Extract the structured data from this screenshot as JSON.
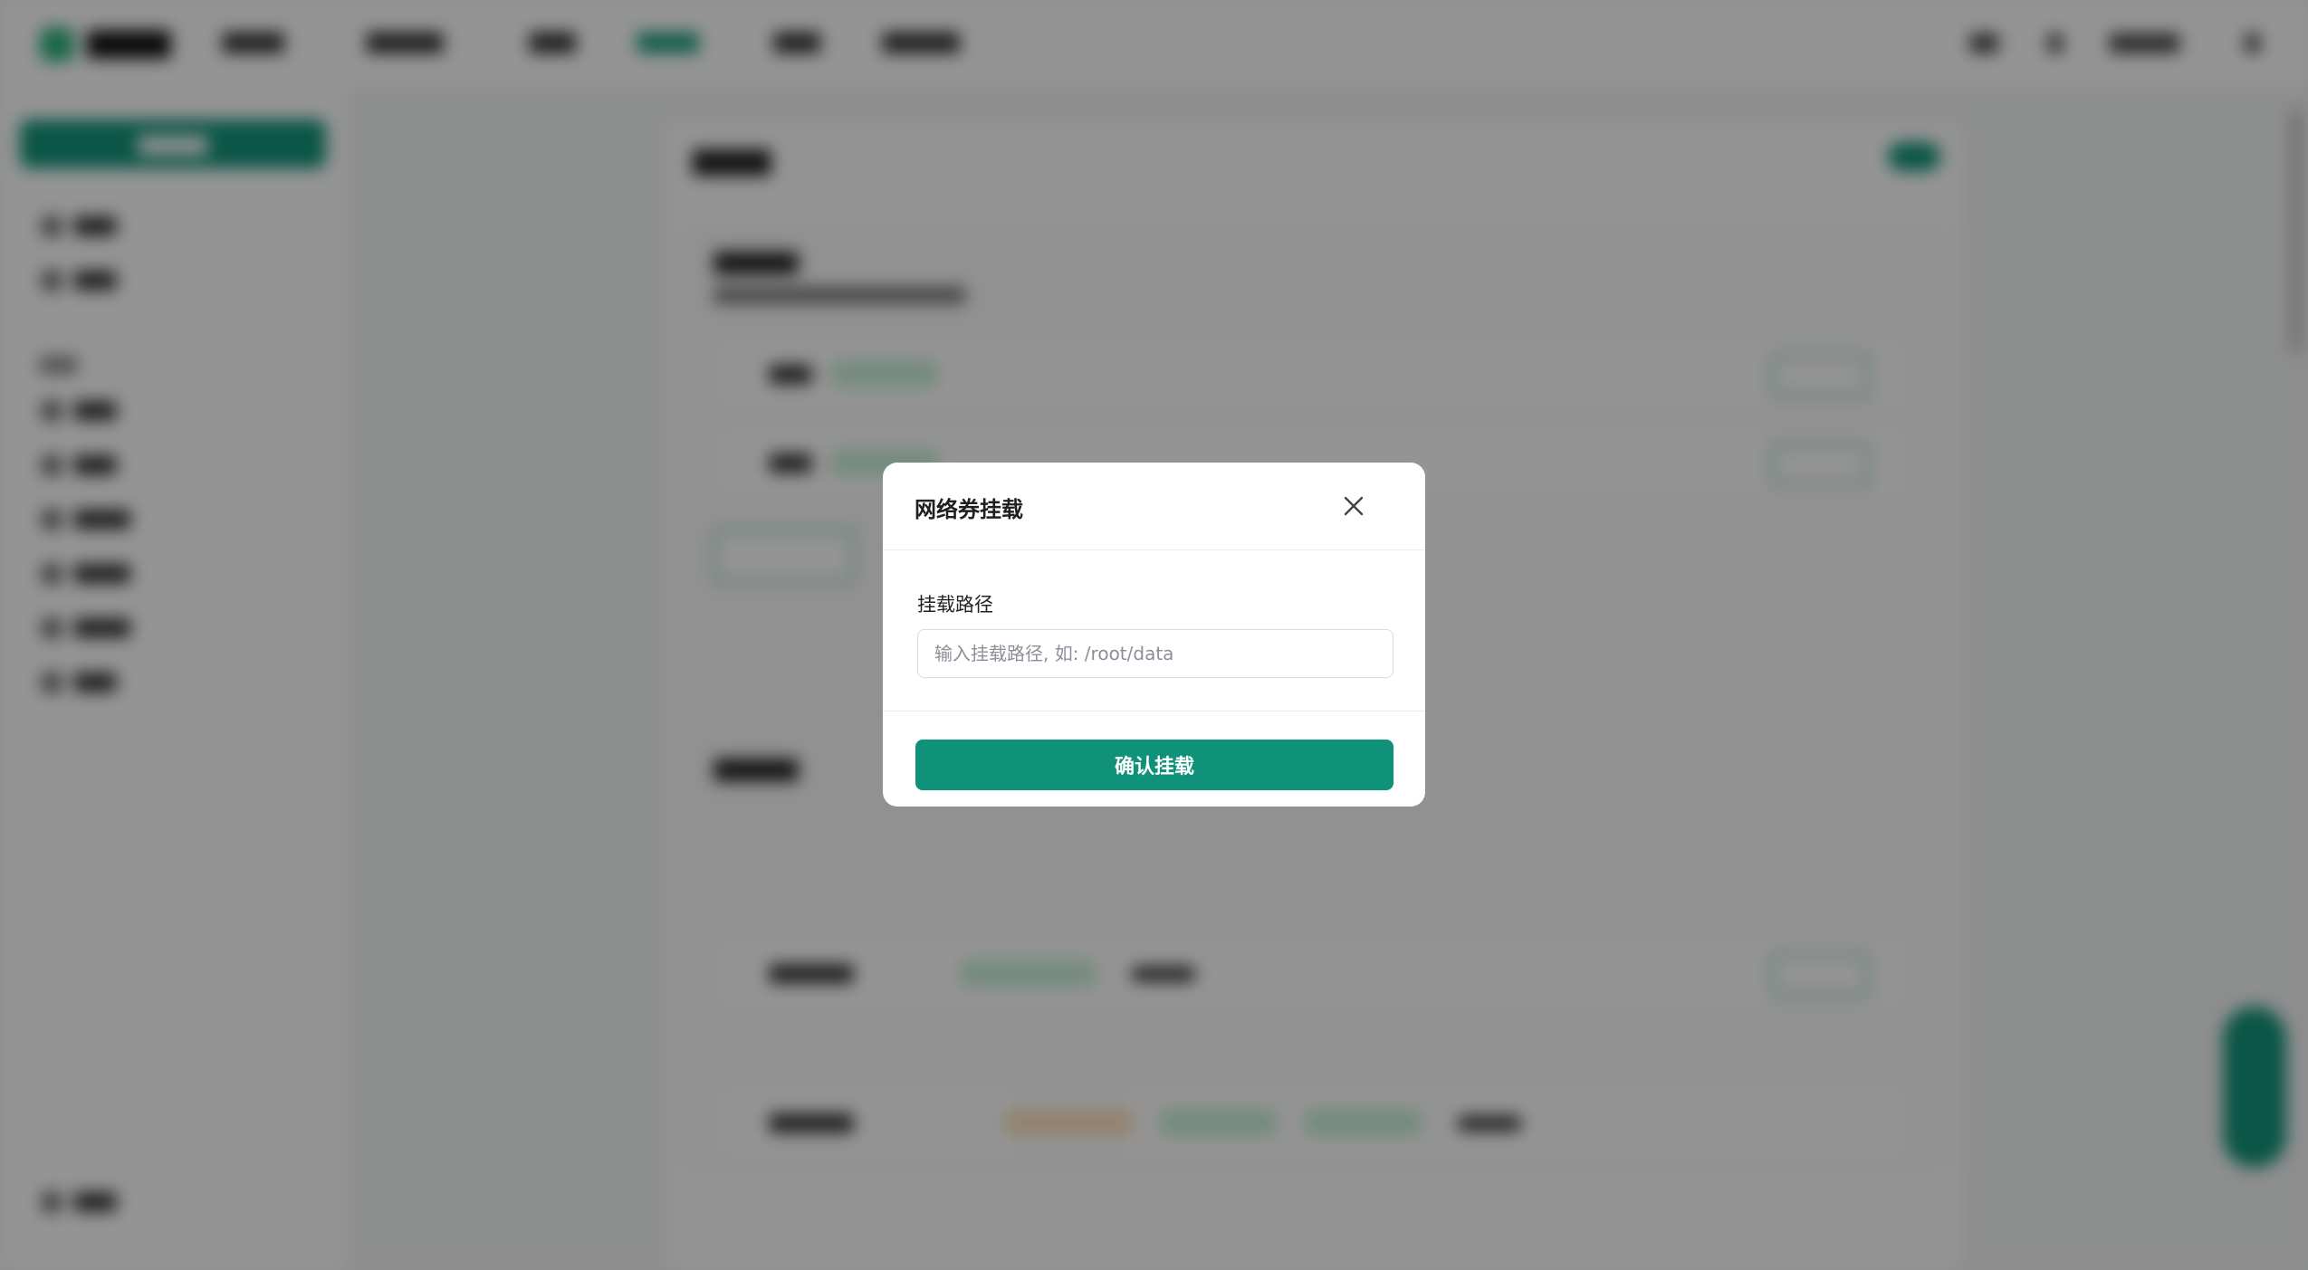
{
  "modal": {
    "title": "网络券挂载",
    "close_icon": "close-icon",
    "field_label": "挂载路径",
    "input_placeholder": "输入挂载路径, 如: /root/data",
    "input_value": "",
    "confirm_label": "确认挂载"
  },
  "colors": {
    "accent": "#0f917a",
    "overlay": "rgba(0,0,0,0.42)"
  }
}
